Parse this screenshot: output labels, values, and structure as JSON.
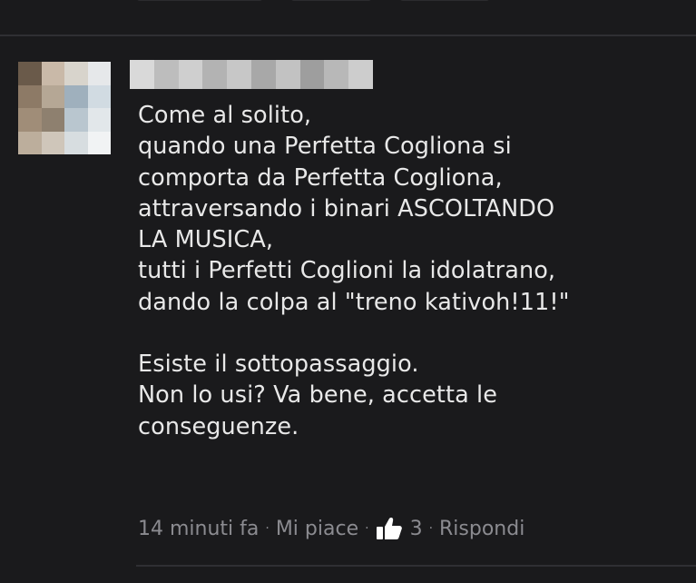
{
  "comment": {
    "author_name": "",
    "lines": [
      "Come al solito,",
      "quando una Perfetta Cogliona si",
      "comporta da Perfetta Cogliona,",
      "attraversando i binari ASCOLTANDO",
      "LA MUSICA,",
      "tutti i Perfetti Coglioni la idolatrano,",
      "dando la colpa al \"treno kativoh!11!\"",
      "",
      "Esiste il sottopassaggio.",
      "Non lo usi? Va bene, accetta le",
      "conseguenze."
    ],
    "meta": {
      "timestamp": "14 minuti fa",
      "like_label": "Mi piace",
      "like_count": "3",
      "reply_label": "Rispondi",
      "separator": "·"
    },
    "icons": {
      "like": "thumbs-up-icon"
    }
  },
  "colors": {
    "background": "#1a1a1c",
    "text": "#e8e8e8",
    "meta_text": "#8b8b90",
    "like_icon": "#ffffff"
  }
}
